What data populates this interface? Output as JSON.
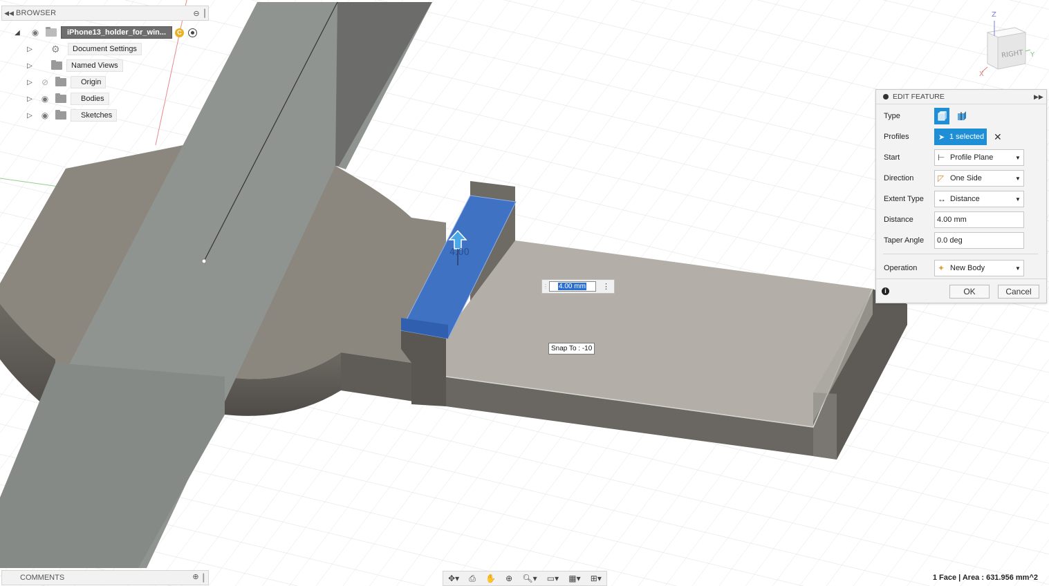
{
  "browser": {
    "title": "BROWSER",
    "root": "iPhone13_holder_for_win...",
    "root_badge": "C",
    "items": [
      {
        "label": "Document Settings",
        "icon": "gear-icon"
      },
      {
        "label": "Named Views",
        "icon": "folder-icon"
      },
      {
        "label": "Origin",
        "icon": "folder-icon",
        "visibility": "hidden"
      },
      {
        "label": "Bodies",
        "icon": "folder-icon",
        "visibility": "visible"
      },
      {
        "label": "Sketches",
        "icon": "folder-icon",
        "visibility": "visible"
      }
    ]
  },
  "comments": {
    "title": "COMMENTS"
  },
  "edit_feature": {
    "title": "EDIT FEATURE",
    "type_label": "Type",
    "profiles_label": "Profiles",
    "profiles_value": "1 selected",
    "start_label": "Start",
    "start_value": "Profile Plane",
    "direction_label": "Direction",
    "direction_value": "One Side",
    "extent_label": "Extent Type",
    "extent_value": "Distance",
    "distance_label": "Distance",
    "distance_value": "4.00 mm",
    "taper_label": "Taper Angle",
    "taper_value": "0.0 deg",
    "operation_label": "Operation",
    "operation_value": "New Body",
    "ok": "OK",
    "cancel": "Cancel"
  },
  "canvas": {
    "distance_input": "4.00 mm",
    "manipulator_label": "4.00",
    "snap_tip": "Snap To : -10",
    "viewcube_face": "RIGHT",
    "axis_z": "Z",
    "axis_x": "X",
    "axis_y": "Y"
  },
  "status": "1 Face | Area : 631.956 mm^2",
  "colors": {
    "selected_face": "#3f72c2",
    "accent": "#1e8fd6",
    "body_top": "#8d8880",
    "body_side": "#67635d",
    "rail": "#8f9490"
  }
}
